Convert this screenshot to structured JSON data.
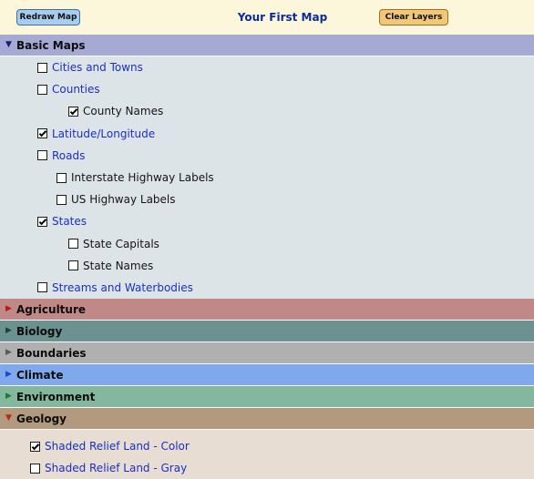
{
  "header": {
    "redraw_label": "Redraw Map",
    "title": "Your First Map",
    "clear_label": "Clear Layers"
  },
  "colors": {
    "basic_maps": "#a5a9d4",
    "agriculture": "#c08886",
    "biology": "#6b9190",
    "boundaries": "#b0b0b0",
    "climate": "#7fa9ec",
    "environment": "#84b89e",
    "geology": "#b3997e"
  },
  "basic_maps": {
    "label": "Basic Maps",
    "items": [
      {
        "label": "Cities and Towns",
        "checked": false,
        "level": 1,
        "link": true
      },
      {
        "label": "Counties",
        "checked": false,
        "level": 1,
        "link": true
      },
      {
        "label": "County Names",
        "checked": true,
        "level": 2,
        "link": false
      },
      {
        "label": "Latitude/Longitude",
        "checked": true,
        "level": 1,
        "link": true
      },
      {
        "label": "Roads",
        "checked": false,
        "level": 1,
        "link": true
      },
      {
        "label": "Interstate Highway Labels",
        "checked": false,
        "level": 2,
        "link": false
      },
      {
        "label": "US Highway Labels",
        "checked": false,
        "level": 2,
        "link": false
      },
      {
        "label": "States",
        "checked": true,
        "level": 1,
        "link": true
      },
      {
        "label": "State Capitals",
        "checked": false,
        "level": 2,
        "link": false
      },
      {
        "label": "State Names",
        "checked": false,
        "level": 2,
        "link": false
      },
      {
        "label": "Streams and Waterbodies",
        "checked": false,
        "level": 1,
        "link": true
      }
    ]
  },
  "categories": {
    "agriculture": "Agriculture",
    "biology": "Biology",
    "boundaries": "Boundaries",
    "climate": "Climate",
    "environment": "Environment",
    "geology": "Geology"
  },
  "geology": {
    "items": [
      {
        "label": "Shaded Relief Land - Color",
        "checked": true,
        "link": true
      },
      {
        "label": "Shaded Relief Land - Gray",
        "checked": false,
        "link": true
      }
    ]
  }
}
